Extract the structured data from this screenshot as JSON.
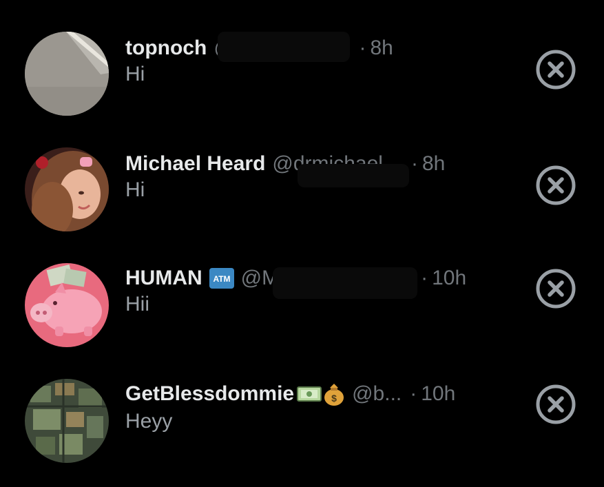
{
  "messages": [
    {
      "name": "topnoch",
      "handle": "@i",
      "separator": "·",
      "time": "8h",
      "text": "Hi",
      "avatar_icon": "wall-photo-avatar"
    },
    {
      "name": "Michael Heard",
      "handle": "@drmichael...",
      "separator": "·",
      "time": "8h",
      "text": "Hi",
      "avatar_icon": "selfie-photo-avatar"
    },
    {
      "name": "HUMAN",
      "badge": "ATM",
      "handle": "@M",
      "separator": "·",
      "time": "10h",
      "text": "Hii",
      "avatar_icon": "piggy-bank-avatar"
    },
    {
      "name": "GetBlessdommie",
      "badges": [
        "money-bills-emoji",
        "money-bag-emoji"
      ],
      "handle": "@b...",
      "separator": "·",
      "time": "10h",
      "text": "Heyy",
      "avatar_icon": "green-map-avatar"
    }
  ],
  "colors": {
    "background": "#000000",
    "name": "#e7e9ea",
    "secondary": "#71767b",
    "message": "#9aa0a6",
    "close_icon": "#9aa0a6",
    "atm_badge": "#3b88c3"
  },
  "close_icon": "close-circle-icon"
}
